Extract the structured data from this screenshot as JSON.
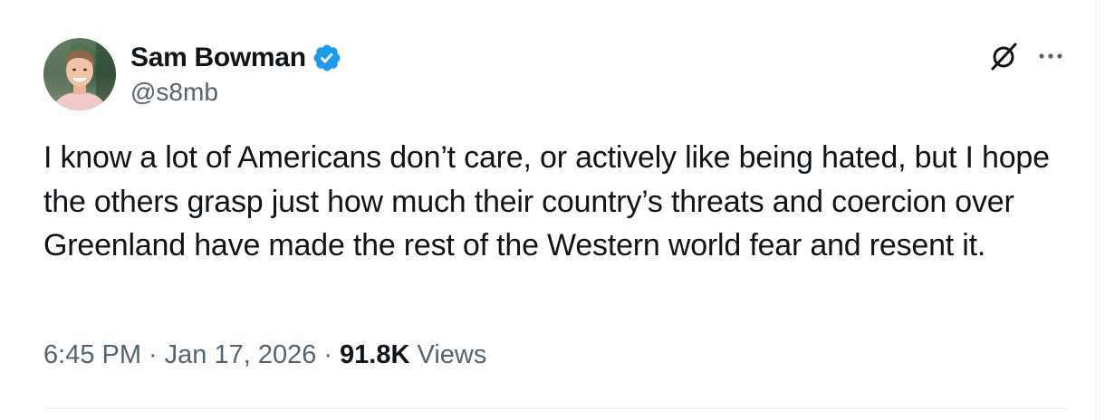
{
  "author": {
    "display_name": "Sam Bowman",
    "handle": "@s8mb",
    "verified": true,
    "verified_color": "#1d9bf0"
  },
  "tweet": {
    "text": "I know a lot of Americans don’t care, or actively like being hated, but I hope the others grasp just how much their country’s threats and coercion over Greenland have made the rest of the Western world fear and resent it."
  },
  "meta": {
    "time": "6:45 PM",
    "separator": "·",
    "date": "Jan 17, 2026",
    "views_count": "91.8K",
    "views_label": "Views"
  },
  "actions": {
    "grok_icon": "grok-icon",
    "more_icon": "more-icon"
  },
  "colors": {
    "text_primary": "#0f1419",
    "text_secondary": "#536471",
    "divider": "#eff3f4"
  }
}
